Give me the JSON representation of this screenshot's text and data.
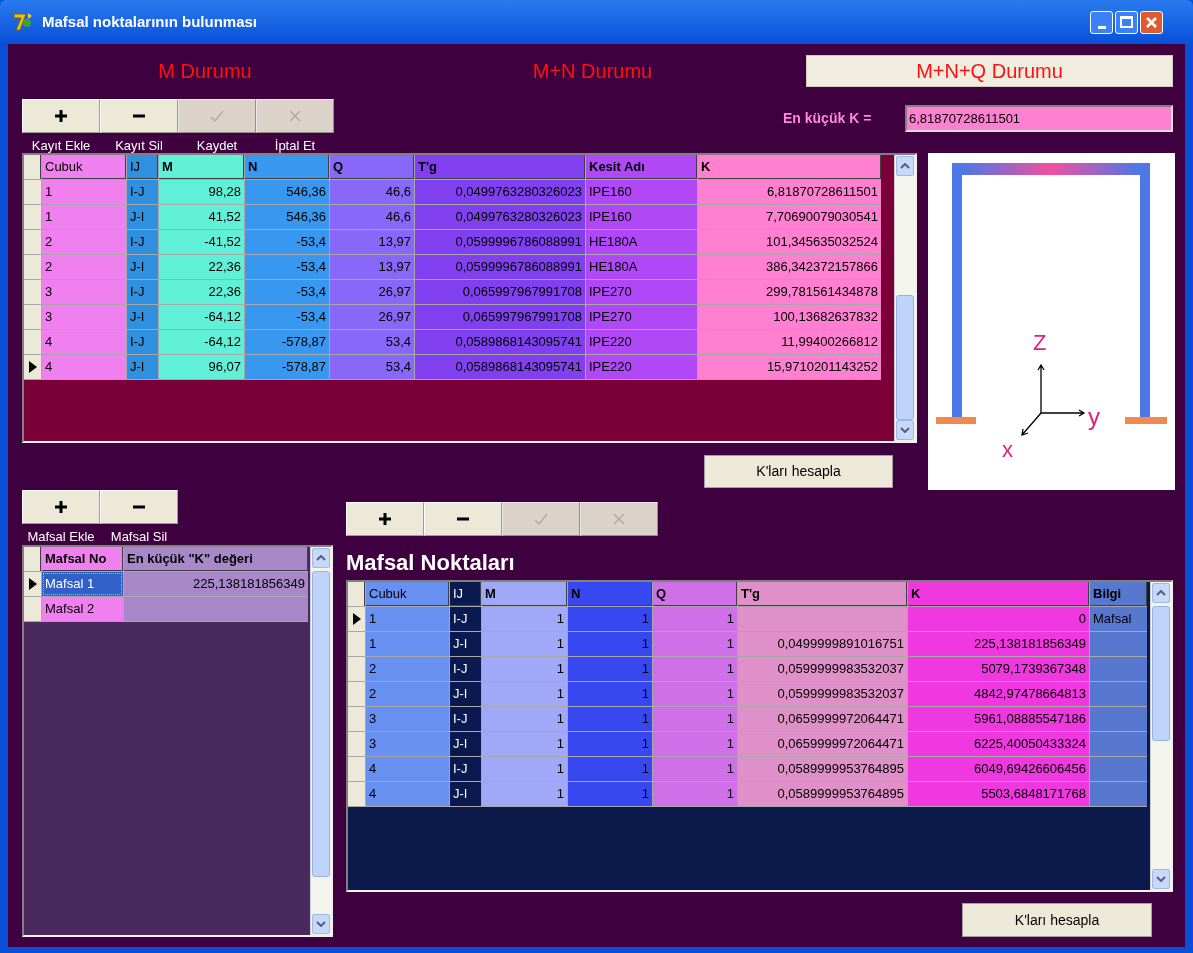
{
  "window": {
    "title": "Mafsal noktalarının bulunması"
  },
  "tabs": [
    {
      "label": "M Durumu",
      "selected": false
    },
    {
      "label": "M+N Durumu",
      "selected": false
    },
    {
      "label": "M+N+Q Durumu",
      "selected": true
    }
  ],
  "record_toolbar": {
    "buttons": [
      {
        "kind": "add",
        "disabled": false
      },
      {
        "kind": "delete",
        "disabled": false
      },
      {
        "kind": "save",
        "disabled": true
      },
      {
        "kind": "cancel",
        "disabled": true
      }
    ],
    "captions": [
      "Kayıt Ekle",
      "Kayıt Sil",
      "Kaydet",
      "İptal Et"
    ]
  },
  "min_k": {
    "label": "En küçük K =",
    "value": "6,81870728611501"
  },
  "members_table": {
    "columns": [
      {
        "title": "Cubuk",
        "bold": false,
        "kind": "text",
        "color": "#f080f0"
      },
      {
        "title": "IJ",
        "bold": false,
        "kind": "text",
        "color": "#3090e0"
      },
      {
        "title": "M",
        "bold": true,
        "kind": "number",
        "color": "#60f0d8"
      },
      {
        "title": "N",
        "bold": true,
        "kind": "number",
        "color": "#3898f0"
      },
      {
        "title": "Q",
        "bold": true,
        "kind": "number",
        "color": "#8868f8"
      },
      {
        "title": "T'g",
        "bold": true,
        "kind": "number",
        "color": "#8040f0"
      },
      {
        "title": "Kesit Adı",
        "bold": true,
        "kind": "text",
        "color": "#b048f8"
      },
      {
        "title": "K",
        "bold": true,
        "kind": "number",
        "color": "#ff80d0"
      }
    ],
    "rows": [
      {
        "current": false,
        "cells": [
          "1",
          "I-J",
          "98,28",
          "546,36",
          "46,6",
          "0,0499763280326023",
          "IPE160",
          "6,81870728611501"
        ]
      },
      {
        "current": false,
        "cells": [
          "1",
          "J-I",
          "41,52",
          "546,36",
          "46,6",
          "0,0499763280326023",
          "IPE160",
          "7,70690079030541"
        ]
      },
      {
        "current": false,
        "cells": [
          "2",
          "I-J",
          "-41,52",
          "-53,4",
          "13,97",
          "0,0599996786088991",
          "HE180A",
          "101,345635032524"
        ]
      },
      {
        "current": false,
        "cells": [
          "2",
          "J-I",
          "22,36",
          "-53,4",
          "13,97",
          "0,0599996786088991",
          "HE180A",
          "386,342372157866"
        ]
      },
      {
        "current": false,
        "cells": [
          "3",
          "I-J",
          "22,36",
          "-53,4",
          "26,97",
          "0,065997967991708",
          "IPE270",
          "299,781561434878"
        ]
      },
      {
        "current": false,
        "cells": [
          "3",
          "J-I",
          "-64,12",
          "-53,4",
          "26,97",
          "0,065997967991708",
          "IPE270",
          "100,13682637832"
        ]
      },
      {
        "current": false,
        "cells": [
          "4",
          "I-J",
          "-64,12",
          "-578,87",
          "53,4",
          "0,0589868143095741",
          "IPE220",
          "11,99400266812"
        ]
      },
      {
        "current": true,
        "cells": [
          "4",
          "J-I",
          "96,07",
          "-578,87",
          "53,4",
          "0,0589868143095741",
          "IPE220",
          "15,9710201143252"
        ]
      }
    ]
  },
  "compute_button_top": {
    "label": "K'ları hesapla"
  },
  "diagram": {
    "axis_labels": [
      "Z",
      "y",
      "x"
    ]
  },
  "hinge_toolbar": {
    "buttons": [
      {
        "kind": "add",
        "disabled": false
      },
      {
        "kind": "delete",
        "disabled": false
      }
    ],
    "captions": [
      "Mafsal Ekle",
      "Mafsal Sil"
    ]
  },
  "hinge_table": {
    "columns": [
      {
        "title": "Mafsal No",
        "bold": true,
        "kind": "text",
        "color": "#f080f0"
      },
      {
        "title": "En küçük \"K\" değeri",
        "bold": true,
        "kind": "number",
        "color": "#a888c8"
      }
    ],
    "rows": [
      {
        "current": true,
        "selected": true,
        "cells": [
          "Mafsal 1",
          "225,138181856349"
        ]
      },
      {
        "current": false,
        "selected": false,
        "cells": [
          "Mafsal 2",
          null
        ]
      }
    ]
  },
  "points_toolbar": {
    "buttons": [
      {
        "kind": "add",
        "disabled": false
      },
      {
        "kind": "delete",
        "disabled": false
      },
      {
        "kind": "save",
        "disabled": true
      },
      {
        "kind": "cancel",
        "disabled": true
      }
    ]
  },
  "points_title": "Mafsal Noktaları",
  "points_table": {
    "columns": [
      {
        "title": "Cubuk",
        "bold": false,
        "kind": "text",
        "color": "#6890f0"
      },
      {
        "title": "IJ",
        "bold": false,
        "kind": "text",
        "color": "#0a1a50"
      },
      {
        "title": "M",
        "bold": true,
        "kind": "number",
        "color": "#a0a8f8"
      },
      {
        "title": "N",
        "bold": true,
        "kind": "number",
        "color": "#3848f0"
      },
      {
        "title": "Q",
        "bold": true,
        "kind": "number",
        "color": "#d070e8"
      },
      {
        "title": "T'g",
        "bold": true,
        "kind": "number",
        "color": "#e090c8"
      },
      {
        "title": "K",
        "bold": true,
        "kind": "number",
        "color": "#f038e0"
      },
      {
        "title": "Bilgi",
        "bold": true,
        "kind": "text",
        "color": "#5878d0"
      }
    ],
    "rows": [
      {
        "current": true,
        "cells": [
          "1",
          "I-J",
          "1",
          "1",
          "1",
          null,
          "0",
          "Mafsal"
        ]
      },
      {
        "current": false,
        "cells": [
          "1",
          "J-I",
          "1",
          "1",
          "1",
          "0,0499999891016751",
          "225,138181856349",
          null
        ]
      },
      {
        "current": false,
        "cells": [
          "2",
          "I-J",
          "1",
          "1",
          "1",
          "0,0599999983532037",
          "5079,1739367348",
          null
        ]
      },
      {
        "current": false,
        "cells": [
          "2",
          "J-I",
          "1",
          "1",
          "1",
          "0,0599999983532037",
          "4842,97478664813",
          null
        ]
      },
      {
        "current": false,
        "cells": [
          "3",
          "I-J",
          "1",
          "1",
          "1",
          "0,0659999972064471",
          "5961,08885547186",
          null
        ]
      },
      {
        "current": false,
        "cells": [
          "3",
          "J-I",
          "1",
          "1",
          "1",
          "0,0659999972064471",
          "6225,40050433324",
          null
        ]
      },
      {
        "current": false,
        "cells": [
          "4",
          "I-J",
          "1",
          "1",
          "1",
          "0,0589999953764895",
          "6049,69426606456",
          null
        ]
      },
      {
        "current": false,
        "cells": [
          "4",
          "J-I",
          "1",
          "1",
          "1",
          "0,0589999953764895",
          "5503,6848171768",
          null
        ]
      }
    ]
  },
  "compute_button_bottom": {
    "label": "K'ları hesapla"
  }
}
